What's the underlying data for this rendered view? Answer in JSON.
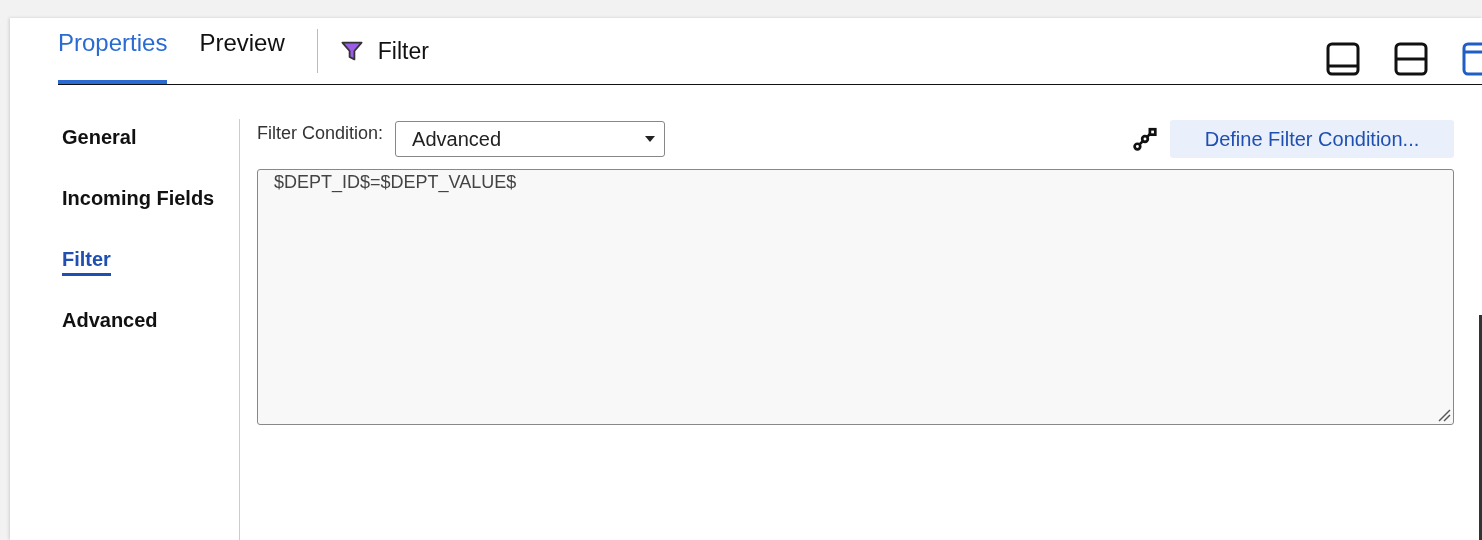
{
  "tabs": [
    {
      "label": "Properties",
      "selected": true
    },
    {
      "label": "Preview",
      "selected": false
    }
  ],
  "object_title": "Filter",
  "layout_buttons": [
    {
      "kind": "bottom",
      "selected": false
    },
    {
      "kind": "split",
      "selected": false
    },
    {
      "kind": "top",
      "selected": true
    }
  ],
  "sidebar": {
    "items": [
      {
        "label": "General",
        "selected": false
      },
      {
        "label": "Incoming Fields",
        "selected": false
      },
      {
        "label": "Filter",
        "selected": true
      },
      {
        "label": "Advanced",
        "selected": false
      }
    ]
  },
  "filter_condition": {
    "label": "Filter Condition:",
    "value": "Advanced"
  },
  "define_button": "Define Filter Condition...",
  "expression": "$DEPT_ID$=$DEPT_VALUE$"
}
